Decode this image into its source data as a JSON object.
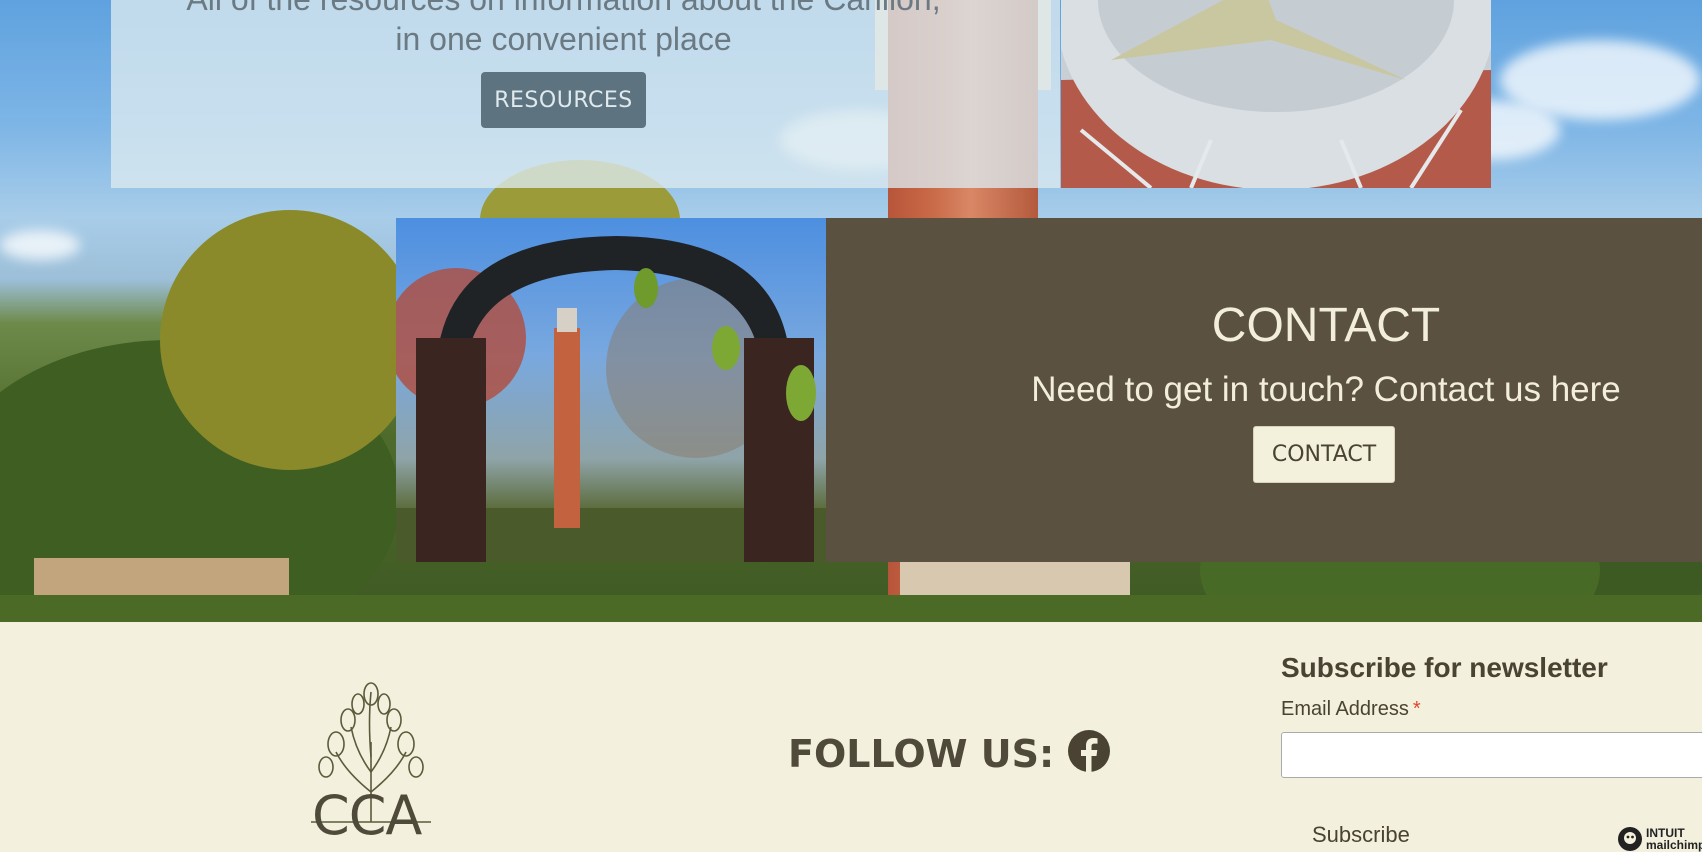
{
  "resources": {
    "line1": "All of the resources on information about the Carillon,",
    "line2": "in one convenient place",
    "button_label": "RESOURCES"
  },
  "contact": {
    "title": "CONTACT",
    "subtitle": "Need to get in touch? Contact us here",
    "button_label": "CONTACT"
  },
  "footer": {
    "logo_text": "CCA",
    "follow_label": "FOLLOW US:",
    "social_icon": "facebook-icon",
    "newsletter": {
      "title": "Subscribe for newsletter",
      "email_label": "Email Address",
      "required_marker": "*",
      "email_value": "",
      "subscribe_label": "Subscribe",
      "badge_line1": "INTUIT",
      "badge_line2": "mailchimp"
    }
  },
  "colors": {
    "contact_bg": "#5a5140",
    "footer_bg": "#f3f1dd",
    "text_dark": "#4a4233",
    "cream": "#f3eedc",
    "required": "#e0442c"
  }
}
